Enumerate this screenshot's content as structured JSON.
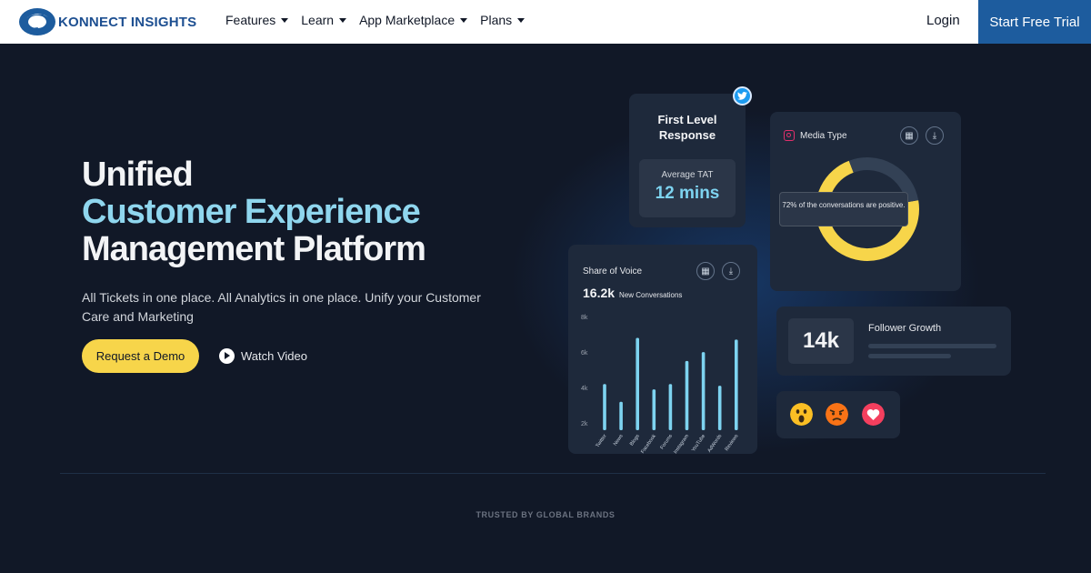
{
  "brand": {
    "name": "KONNECT INSIGHTS"
  },
  "nav": {
    "items": [
      {
        "label": "Features"
      },
      {
        "label": "Learn"
      },
      {
        "label": "App Marketplace"
      },
      {
        "label": "Plans"
      }
    ],
    "login": "Login",
    "cta": "Start Free Trial"
  },
  "hero": {
    "line1": "Unified",
    "line2": "Customer Experience",
    "line3": "Management Platform",
    "subtitle": "All Tickets in one place. All Analytics in one place. Unify your Customer Care and Marketing",
    "demo_button": "Request a Demo",
    "watch_video": "Watch Video"
  },
  "cards": {
    "first_level": {
      "title": "First Level Response",
      "metric_label": "Average TAT",
      "metric_value": "12 mins"
    },
    "media_type": {
      "title": "Media Type",
      "tooltip": "72% of the conversations are positive."
    },
    "share_of_voice": {
      "title": "Share of Voice",
      "count": "16.2k",
      "count_label": "New Conversations"
    },
    "follower_growth": {
      "value": "14k",
      "label": "Follower Growth"
    }
  },
  "trusted": "TRUSTED BY GLOBAL BRANDS",
  "colors": {
    "accent": "#8fd6ee",
    "cta": "#1d5c9e",
    "demo": "#f7d54a",
    "donut": "#f7d54a",
    "bars": "#7dd3f0"
  },
  "chart_data": [
    {
      "type": "bar",
      "title": "Share of Voice",
      "categories": [
        "Twitter",
        "News",
        "Blogs",
        "Facebook",
        "Forums",
        "Instagram",
        "YouTube",
        "AdWords",
        "Reviews"
      ],
      "values": [
        4200,
        3200,
        6800,
        3900,
        4200,
        5500,
        6000,
        4100,
        6700
      ],
      "ylim": [
        1600,
        8000
      ],
      "yticks": [
        "2k",
        "4k",
        "6k",
        "8k"
      ],
      "ytick_values": [
        2000,
        4000,
        6000,
        8000
      ]
    },
    {
      "type": "pie",
      "title": "Media Type",
      "values": [
        72,
        28
      ],
      "colors": [
        "#f7d54a",
        "#334155"
      ]
    }
  ]
}
